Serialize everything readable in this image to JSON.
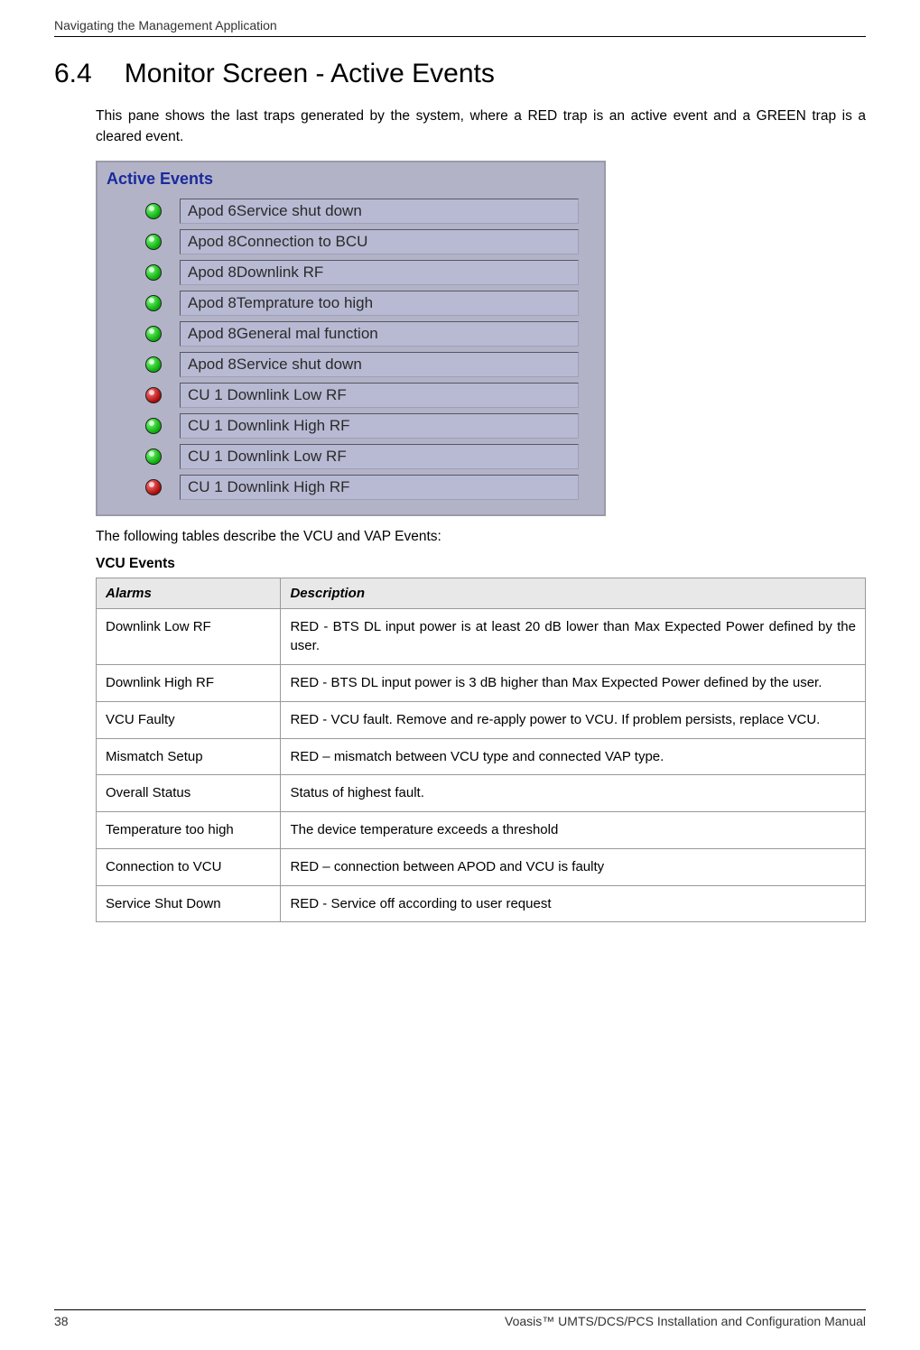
{
  "header": {
    "breadcrumb": "Navigating the Management Application"
  },
  "section": {
    "number": "6.4",
    "title": "Monitor Screen - Active Events",
    "intro": "This pane shows the last traps generated by the system, where a RED trap is an active event and a GREEN trap is a cleared event.",
    "after_panel": "The following tables describe the VCU and VAP Events:"
  },
  "active_events_panel": {
    "title": "Active Events",
    "rows": [
      {
        "status": "green",
        "text": "Apod 6Service shut down"
      },
      {
        "status": "green",
        "text": "Apod 8Connection to BCU"
      },
      {
        "status": "green",
        "text": "Apod 8Downlink RF"
      },
      {
        "status": "green",
        "text": "Apod 8Temprature too high"
      },
      {
        "status": "green",
        "text": "Apod 8General mal function"
      },
      {
        "status": "green",
        "text": "Apod 8Service shut down"
      },
      {
        "status": "red",
        "text": "CU 1 Downlink Low RF"
      },
      {
        "status": "green",
        "text": "CU 1 Downlink High RF"
      },
      {
        "status": "green",
        "text": "CU 1 Downlink Low RF"
      },
      {
        "status": "red",
        "text": "CU 1 Downlink High RF"
      }
    ]
  },
  "vcu_table": {
    "heading": "VCU Events",
    "headers": {
      "col1": "Alarms",
      "col2": "Description"
    },
    "rows": [
      {
        "alarm": "Downlink Low RF",
        "desc": "RED - BTS DL input power is at least 20 dB lower than Max Expected Power defined by the user."
      },
      {
        "alarm": "Downlink High RF",
        "desc": "RED - BTS DL input power is 3 dB higher than Max Expected Power defined by the user."
      },
      {
        "alarm": "VCU Faulty",
        "desc": "RED - VCU fault. Remove and re-apply power to VCU. If problem persists, replace VCU."
      },
      {
        "alarm": "Mismatch Setup",
        "desc": "RED – mismatch between VCU type and connected VAP type."
      },
      {
        "alarm": "Overall Status",
        "desc": "Status of highest fault."
      },
      {
        "alarm": "Temperature too high",
        "desc": "The device temperature exceeds a threshold"
      },
      {
        "alarm": "Connection to VCU",
        "desc": "RED – connection between APOD and VCU is faulty"
      },
      {
        "alarm": "Service Shut Down",
        "desc": "RED - Service off according to user request"
      }
    ]
  },
  "footer": {
    "page": "38",
    "manual_title": "Voasis™ UMTS/DCS/PCS Installation and Configuration Manual"
  }
}
